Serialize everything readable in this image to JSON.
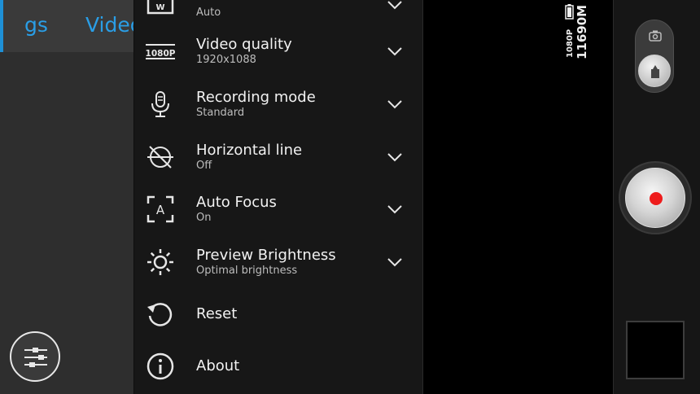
{
  "tabs": [
    {
      "label": "gs"
    },
    {
      "label": "Video"
    }
  ],
  "settings": {
    "items": [
      {
        "title": "",
        "subtitle": "Auto",
        "icon": "white-balance-icon"
      },
      {
        "title": "Video quality",
        "subtitle": "1920x1088",
        "icon": "resolution-1080p-icon",
        "icon_text": "1080P"
      },
      {
        "title": "Recording mode",
        "subtitle": "Standard",
        "icon": "microphone-icon"
      },
      {
        "title": "Horizontal line",
        "subtitle": "Off",
        "icon": "horizontal-line-icon"
      },
      {
        "title": "Auto Focus",
        "subtitle": "On",
        "icon": "auto-focus-icon",
        "icon_text": "A"
      },
      {
        "title": "Preview Brightness",
        "subtitle": "Optimal brightness",
        "icon": "brightness-icon"
      },
      {
        "title": "Reset",
        "icon": "reset-icon"
      },
      {
        "title": "About",
        "icon": "info-icon"
      }
    ]
  },
  "status": {
    "resolution": "1080P",
    "storage": "11690M"
  },
  "colors": {
    "accent": "#1e90d6",
    "record": "#ee1c1c"
  }
}
